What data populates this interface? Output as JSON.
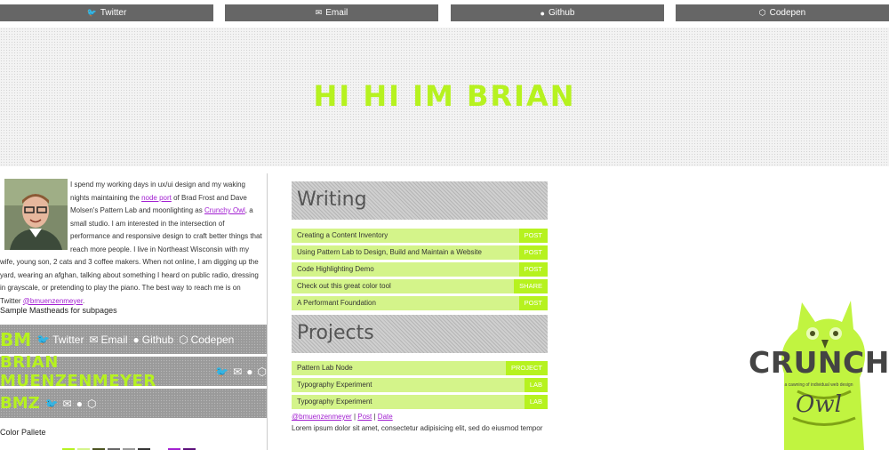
{
  "nav": [
    {
      "icon": "twitter-icon",
      "label": "Twitter"
    },
    {
      "icon": "email-icon",
      "label": "Email"
    },
    {
      "icon": "github-icon",
      "label": "Github"
    },
    {
      "icon": "codepen-icon",
      "label": "Codepen"
    }
  ],
  "masthead": {
    "title": "HI HI IM BRIAN"
  },
  "bio": {
    "p1": "I spend my working days in ux/ui design and my waking nights maintaining the ",
    "link1": "node port",
    "p2": " of Brad Frost and Dave Molsen's Pattern Lab and moonlighting as ",
    "link2": "Crunchy Owl",
    "p3": ", a small studio. I am interested in the intersection of performance and responsive design to craft better things that reach more people. I live in Northeast Wisconsin with my wife, young son, 2 cats and 3 coffee makers. When not online, I am digging up the yard, wearing an afghan, talking about something I heard on public radio, dressing in grayscale, or pretending to play the piano. The best way to reach me is on Twitter ",
    "link3": "@bmuenzenmeyer",
    "p4": "."
  },
  "samples": {
    "label": "Sample Mastheads for subpages",
    "m1": {
      "logo": "BM",
      "links": [
        "Twitter",
        "Email",
        "Github",
        "Codepen"
      ]
    },
    "m2": {
      "logo": "BRIAN MUENZENMEYER"
    },
    "m3": {
      "logo": "BMZ"
    }
  },
  "palette": {
    "label": "Color Pallete",
    "colors": [
      "#b6f21f",
      "#d4f48a",
      "#4b5320",
      "#666666",
      "#999999",
      "#333333",
      "#ffffff",
      "#a21fd1",
      "#5b0f7a"
    ]
  },
  "writing": {
    "heading": "Writing",
    "rows": [
      {
        "title": "Creating a Content Inventory",
        "tag": "POST"
      },
      {
        "title": "Using Pattern Lab to Design, Build and Maintain a Website",
        "tag": "POST"
      },
      {
        "title": "Code Highlighting Demo",
        "tag": "POST"
      },
      {
        "title": "Check out this great color tool",
        "tag": "SHARE"
      },
      {
        "title": "A Performant Foundation",
        "tag": "POST"
      }
    ]
  },
  "projects": {
    "heading": "Projects",
    "rows": [
      {
        "title": "Pattern Lab Node",
        "tag": "PROJECT"
      },
      {
        "title": "Typography Experiment",
        "tag": "LAB"
      },
      {
        "title": "Typography Experiment",
        "tag": "LAB"
      }
    ]
  },
  "meta": {
    "author": "@bmuenzenmeyer",
    "sep": " | ",
    "post": "Post",
    "date": "Date"
  },
  "lorem": "Lorem ipsum dolor sit amet, consectetur adipisicing elit, sed do eiusmod tempor",
  "crunchy": {
    "title": "CRUNCHY",
    "tagline": "a cawning of individual web design",
    "script": "Owl"
  }
}
